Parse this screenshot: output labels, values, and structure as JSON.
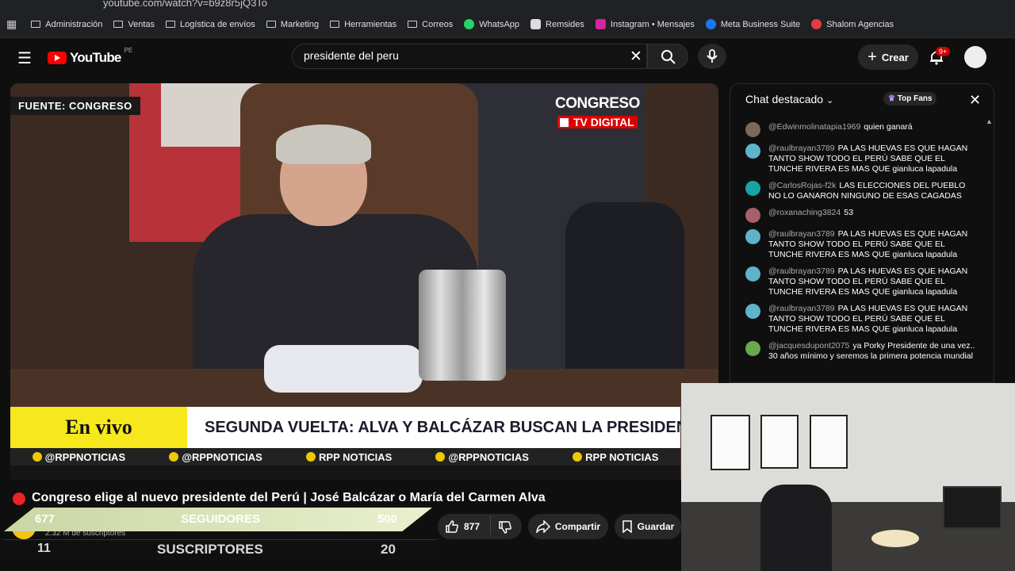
{
  "browser": {
    "url": "youtube.com/watch?v=b9z8r5jQ3To",
    "bookmarks": [
      "Administración",
      "Ventas",
      "Logística de envíos",
      "Marketing",
      "Herramientas",
      "Correos",
      "WhatsApp",
      "Remsides",
      "Instagram • Mensajes",
      "Meta Business Suite",
      "Shalom Agencias"
    ]
  },
  "youtube": {
    "logo": "YouTube",
    "region": "PE",
    "search_value": "presidente del peru",
    "create_label": "Crear",
    "notifications": "9+"
  },
  "video": {
    "source_label": "FUENTE: CONGRESO",
    "congreso": "CONGRESO",
    "tv_digital": "TV DIGITAL",
    "en_vivo": "En vivo",
    "headline": "SEGUNDA VUELTA: ALVA Y BALCÁZAR BUSCAN LA PRESIDENC",
    "social": [
      "@RPPNOTICIAS",
      "@RPPNOTICIAS",
      "RPP NOTICIAS",
      "@RPPNOTICIAS",
      "RPP NOTICIAS"
    ]
  },
  "title": "Congreso elige al nuevo presidente del Perú | José Balcázar o María del Carmen Alva",
  "channel_subs": "2.32 M de suscriptores",
  "overlay": {
    "followers_count": "677",
    "followers_label": "SEGUIDORES",
    "followers_target": "500",
    "subs_count": "11",
    "subs_label": "SUSCRIPTORES",
    "subs_target": "20"
  },
  "actions": {
    "likes": "877",
    "share": "Compartir",
    "save": "Guardar"
  },
  "chat": {
    "title": "Chat destacado",
    "top_fans": "Top Fans",
    "messages": [
      {
        "user": "@Edwinmolinatapia1969",
        "text": "quien ganará",
        "color": "#7b6a5a"
      },
      {
        "user": "@raulbrayan3789",
        "text": "PA LAS HUEVAS ES QUE HAGAN TANTO SHOW TODO EL PERÚ SABE QUE EL TUNCHE RIVERA ES MAS QUE gianluca lapadula",
        "color": "#5fb3c9"
      },
      {
        "user": "@CarlosRojas-f2k",
        "text": "LAS ELECCIONES DEL PUEBLO NO LO GANARON NINGUNO DE ESAS CAGADAS",
        "color": "#1aa3a3"
      },
      {
        "user": "@roxanaching3824",
        "text": "53",
        "color": "#a85f6a"
      },
      {
        "user": "@raulbrayan3789",
        "text": "PA LAS HUEVAS ES QUE HAGAN TANTO SHOW TODO EL PERÚ SABE QUE EL TUNCHE RIVERA ES MAS QUE gianluca lapadula",
        "color": "#5fb3c9"
      },
      {
        "user": "@raulbrayan3789",
        "text": "PA LAS HUEVAS ES QUE HAGAN TANTO SHOW TODO EL PERÚ SABE QUE EL TUNCHE RIVERA ES MAS QUE gianluca lapadula",
        "color": "#5fb3c9"
      },
      {
        "user": "@raulbrayan3789",
        "text": "PA LAS HUEVAS ES QUE HAGAN TANTO SHOW TODO EL PERÚ SABE QUE EL TUNCHE RIVERA ES MAS QUE gianluca lapadula",
        "color": "#5fb3c9"
      },
      {
        "user": "@jacquesdupont2075",
        "text": "ya Porky Presidente de una vez.. 30 años mínimo y seremos la primera potencia mundial",
        "color": "#6aa84f"
      }
    ]
  }
}
